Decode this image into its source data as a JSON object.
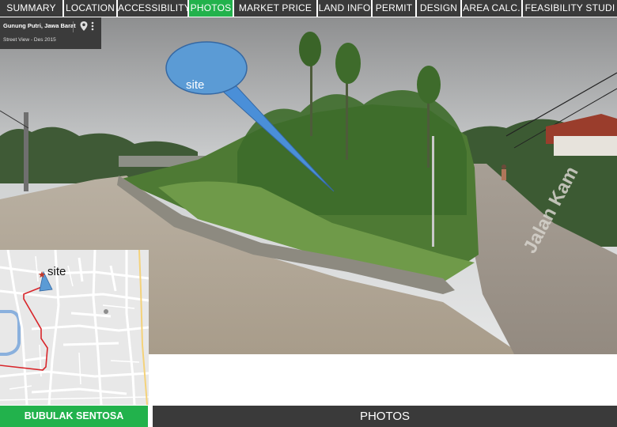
{
  "nav": {
    "tabs": [
      {
        "label": "SUMMARY",
        "active": false
      },
      {
        "label": "LOCATION",
        "active": false
      },
      {
        "label": "ACCESSIBILITY",
        "active": false
      },
      {
        "label": "PHOTOS",
        "active": true
      },
      {
        "label": "MARKET PRICE",
        "active": false
      },
      {
        "label": "LAND INFO",
        "active": false
      },
      {
        "label": "PERMIT",
        "active": false
      },
      {
        "label": "DESIGN",
        "active": false
      },
      {
        "label": "AREA CALC.",
        "active": false
      },
      {
        "label": "FEASIBILITY  STUDI",
        "active": false
      }
    ],
    "active_color": "#22b24c",
    "tab_color": "#3a3a3a"
  },
  "streetview": {
    "place": "Gunung Putri, Jawa Barat",
    "capture": "Street View - Des 2015",
    "pin_icon": "map-pin-icon",
    "menu_icon": "more-vert-icon",
    "callout_label": "site"
  },
  "map": {
    "marker_label": "site",
    "marker_icon": "star-marker-icon",
    "pegman_icon": "pegman-icon",
    "route_color": "#d8252a"
  },
  "footer": {
    "project_name": "BUBULAK SENTOSA",
    "section_title": "PHOTOS",
    "project_color": "#22b24c"
  }
}
